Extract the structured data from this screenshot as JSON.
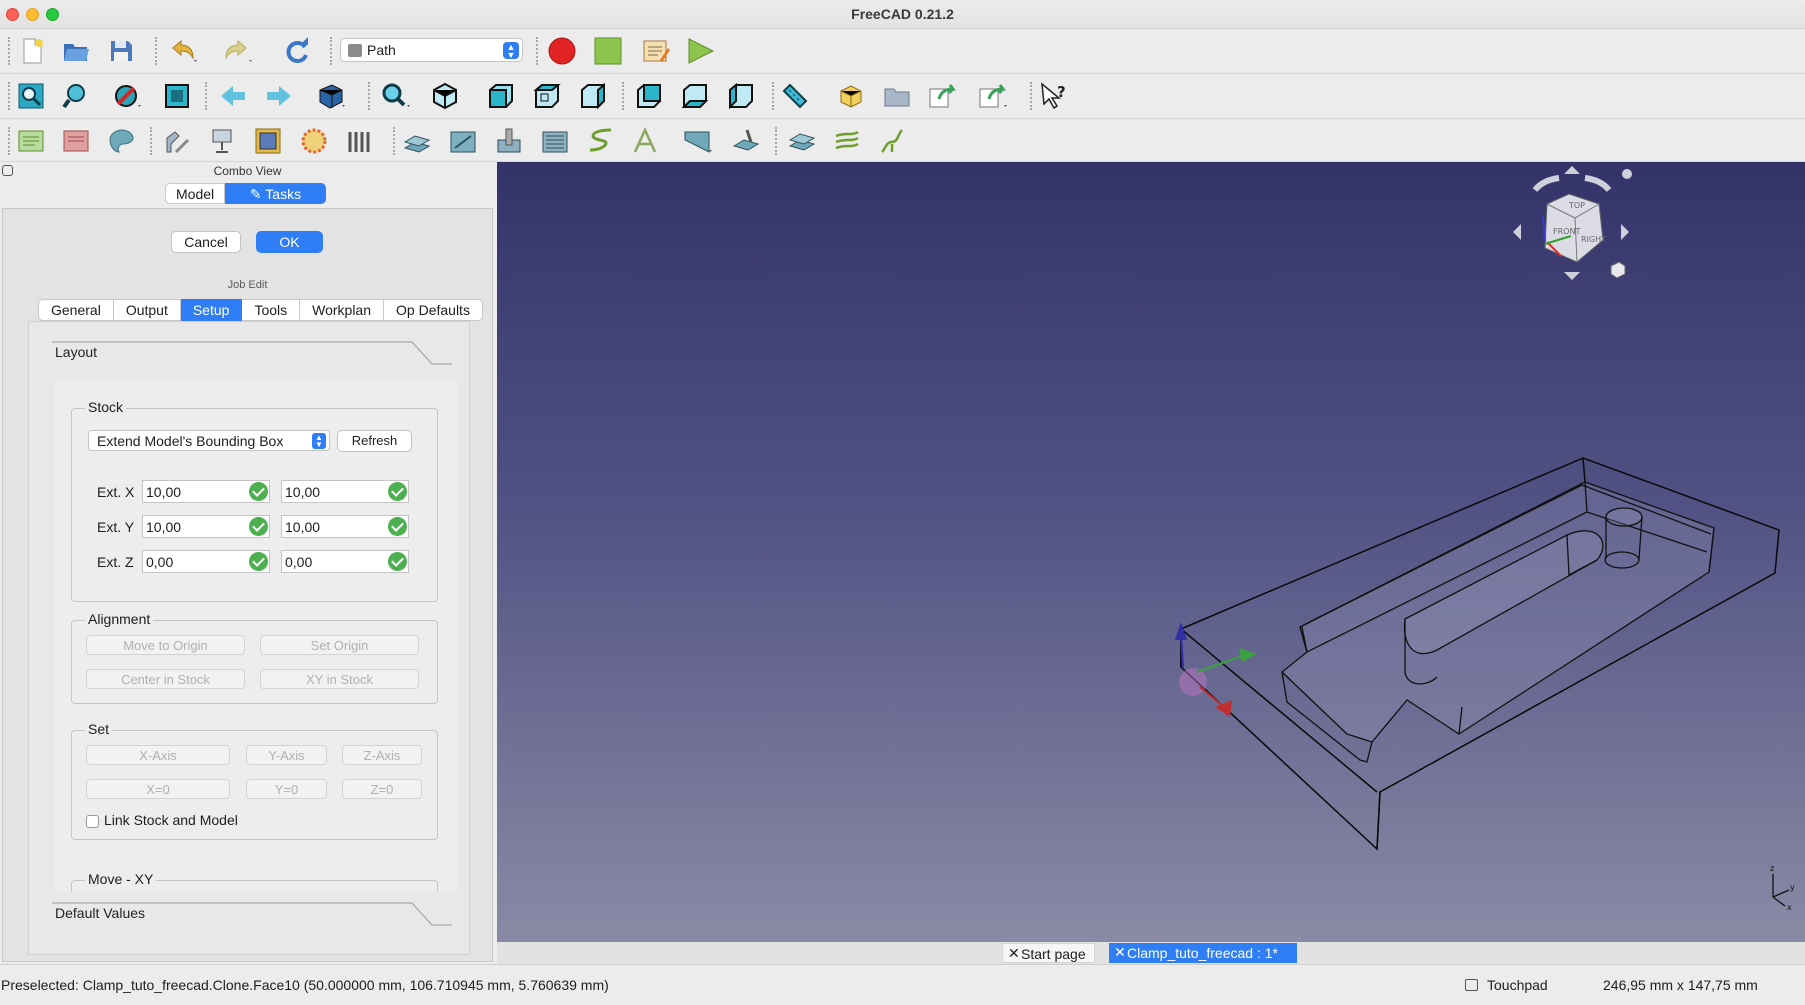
{
  "app": {
    "title": "FreeCAD 0.21.2"
  },
  "toolbar": {
    "workbench": "Path",
    "row1_icons": [
      "new-document-icon",
      "open-icon",
      "save-icon",
      "undo-icon",
      "redo-icon",
      "refresh-icon",
      "record-macro-icon",
      "stop-macro-icon",
      "macros-icon",
      "execute-macro-icon"
    ],
    "row2_icons": [
      "fit-all-icon",
      "fit-selection-icon",
      "draw-style-icon",
      "bounding-box-icon",
      "back-icon",
      "forward-icon",
      "std-views-icon",
      "zoom-icon",
      "isometric-view-icon",
      "front-view-icon",
      "top-view-icon",
      "right-view-icon",
      "rear-view-icon",
      "bottom-view-icon",
      "left-view-icon",
      "measure-distance-icon",
      "part-icon",
      "group-icon",
      "link-icon",
      "link-actions-icon",
      "whats-this-icon"
    ],
    "row3_icons": [
      "job-icon",
      "post-process-icon",
      "export-icon",
      "toolbit-icon",
      "tool-controller-icon",
      "fixture-icon",
      "comment-icon",
      "stop-icon",
      "profile-icon",
      "pocket-icon",
      "drilling-icon",
      "face-icon",
      "helix-icon",
      "engrave-icon",
      "adaptive-icon",
      "deburr-icon",
      "simulator-icon",
      "inspect-icon",
      "array-icon"
    ]
  },
  "combo_view": {
    "title": "Combo View",
    "tabs": [
      {
        "label": "Model"
      },
      {
        "label": "Tasks"
      }
    ],
    "active_tab": "Tasks"
  },
  "task": {
    "cancel_label": "Cancel",
    "ok_label": "OK",
    "panel_title": "Job Edit",
    "tabs": [
      "General",
      "Output",
      "Setup",
      "Tools",
      "Workplan",
      "Op Defaults"
    ],
    "active_tab": "Setup",
    "layout_section": "Layout",
    "default_values_section": "Default Values",
    "stock": {
      "title": "Stock",
      "mode": "Extend Model's Bounding Box",
      "refresh_label": "Refresh",
      "rows": [
        {
          "label": "Ext. X",
          "neg": "10,00",
          "pos": "10,00"
        },
        {
          "label": "Ext. Y",
          "neg": "10,00",
          "pos": "10,00"
        },
        {
          "label": "Ext. Z",
          "neg": "0,00",
          "pos": "0,00"
        }
      ]
    },
    "alignment": {
      "title": "Alignment",
      "move_to_origin": "Move to Origin",
      "set_origin": "Set Origin",
      "center_in_stock": "Center in Stock",
      "xy_in_stock": "XY in Stock"
    },
    "set": {
      "title": "Set",
      "x_axis": "X-Axis",
      "y_axis": "Y-Axis",
      "z_axis": "Z-Axis",
      "x0": "X=0",
      "y0": "Y=0",
      "z0": "Z=0",
      "link_label": "Link Stock and Model",
      "link_checked": false
    },
    "move_xy": {
      "title": "Move - XY"
    }
  },
  "viewport": {
    "background_top": "#33336a",
    "background_bottom": "#8a8aa6",
    "navcube_faces": [
      "TOP",
      "FRONT",
      "RIGHT"
    ],
    "axis_labels": [
      "z",
      "y",
      "x"
    ]
  },
  "documents": {
    "tabs": [
      {
        "label": "Start page",
        "active": false
      },
      {
        "label": "Clamp_tuto_freecad : 1*",
        "active": true
      }
    ]
  },
  "status": {
    "message": "Preselected: Clamp_tuto_freecad.Clone.Face10 (50.000000 mm, 106.710945 mm, 5.760639 mm)",
    "navigation": "Touchpad",
    "dimensions": "246,95 mm x 147,75 mm"
  },
  "colors": {
    "accent": "#2f7ef6",
    "record": "#e02424",
    "ok_check": "#4caf50"
  }
}
